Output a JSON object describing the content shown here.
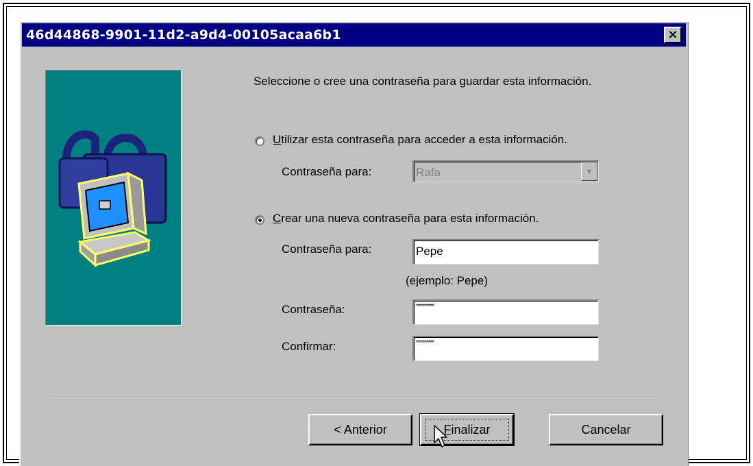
{
  "window": {
    "title": "46d44868-9901-11d2-a9d4-00105acaa6b1",
    "close_label": "×"
  },
  "intro_text": "Seleccione o cree una contraseña para guardar esta información.",
  "option_existing": {
    "label_accel": "U",
    "label_rest": "tilizar esta contraseña para acceder a esta información.",
    "selected": false,
    "password_for_label": "Contraseña para:",
    "password_for_value": "Rafa"
  },
  "option_new": {
    "label_accel": "C",
    "label_rest": "rear una nueva contraseña para esta información.",
    "selected": true,
    "password_for_label": "Contraseña para:",
    "password_for_value": "Pepe",
    "example_hint": "(ejemplo: Pepe)",
    "password_label": "Contraseña:",
    "password_value": "*********",
    "confirm_label": "Confirmar:",
    "confirm_value": "*********"
  },
  "buttons": {
    "back": "< Anterior",
    "finish_accel": "F",
    "finish_rest": "inalizar",
    "cancel": "Cancelar"
  },
  "colors": {
    "titlebar": "#000080",
    "panel": "#008080",
    "dialog_bg": "#c0c0c0"
  },
  "icons": [
    "close-icon",
    "padlock-icon",
    "computer-icon",
    "dropdown-arrow-icon",
    "mouse-pointer-icon"
  ]
}
